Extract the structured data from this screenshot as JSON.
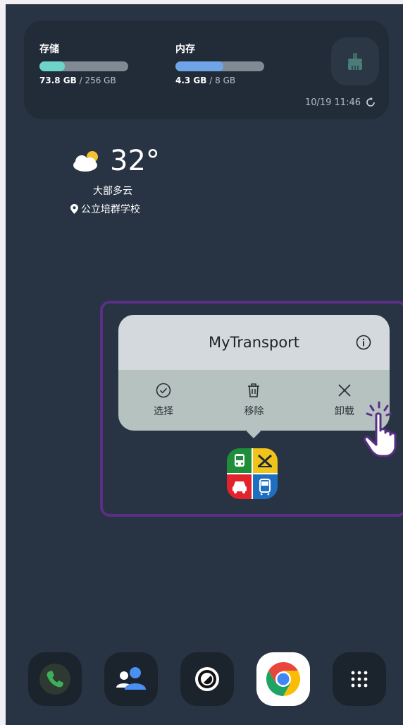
{
  "storage_widget": {
    "storage": {
      "label": "存储",
      "used": "73.8 GB",
      "total": "/ 256 GB",
      "fraction": 0.288,
      "color": "#6ed3c9"
    },
    "memory": {
      "label": "内存",
      "used": "4.3 GB",
      "total": "/ 8 GB",
      "fraction": 0.54,
      "color": "#6fa5e8"
    },
    "timestamp": "10/19 11:46",
    "clean_icon": "broom-icon",
    "refresh_icon": "refresh-icon"
  },
  "weather": {
    "temperature": "32°",
    "condition": "大部多云",
    "location": "公立培群学校",
    "icon": "partly-cloudy-icon"
  },
  "popup": {
    "title": "MyTransport",
    "info_icon": "info-icon",
    "actions": [
      {
        "label": "选择",
        "icon": "check-circle-icon"
      },
      {
        "label": "移除",
        "icon": "trash-icon"
      },
      {
        "label": "卸载",
        "icon": "close-icon"
      }
    ]
  },
  "app": {
    "name": "MyTransport",
    "icon": "mytransport-icon"
  },
  "highlight_color": "#5a2f86",
  "dock": [
    {
      "name": "phone",
      "icon": "phone-icon"
    },
    {
      "name": "contacts",
      "icon": "contacts-icon"
    },
    {
      "name": "camera",
      "icon": "camera-icon"
    },
    {
      "name": "chrome",
      "icon": "chrome-icon"
    },
    {
      "name": "app-drawer",
      "icon": "grid-icon"
    }
  ]
}
